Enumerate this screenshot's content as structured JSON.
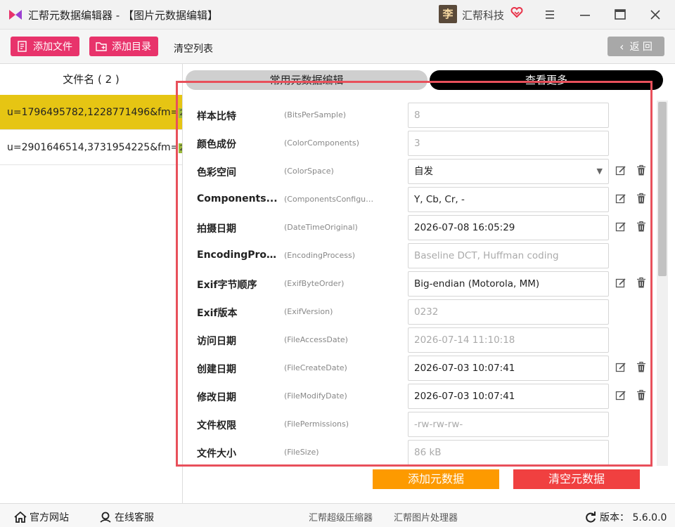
{
  "window": {
    "title": "汇帮元数据编辑器 - 【图片元数据编辑】",
    "brand_avatar_char": "李",
    "brand_name": "汇帮科技"
  },
  "toolbar": {
    "add_file": "添加文件",
    "add_dir": "添加目录",
    "clear_list": "清空列表",
    "back": "返 回"
  },
  "file_list": {
    "header": "文件名 ( 2 )",
    "items": [
      {
        "name": "u=1796495782,1228771496&fm=",
        "tag": "2(",
        "selected": true
      },
      {
        "name": "u=2901646514,3731954225&fm=",
        "tag": "2(",
        "selected": false
      }
    ]
  },
  "tabs": {
    "common": "常用元数据编辑",
    "more": "查看更多"
  },
  "fields": [
    {
      "cn": "样本比特",
      "en": "(BitsPerSample)",
      "value": "8",
      "editable": false
    },
    {
      "cn": "颜色成份",
      "en": "(ColorComponents)",
      "value": "3",
      "editable": false
    },
    {
      "cn": "色彩空间",
      "en": "(ColorSpace)",
      "value": "自发",
      "editable": true,
      "dropdown": true
    },
    {
      "cn": "Components...",
      "en": "(ComponentsConfigur...",
      "value": "Y, Cb, Cr, -",
      "editable": true
    },
    {
      "cn": "拍摄日期",
      "en": "(DateTimeOriginal)",
      "value": "2026-07-08 16:05:29",
      "editable": true
    },
    {
      "cn": "EncodingProc...",
      "en": "(EncodingProcess)",
      "value": "Baseline DCT, Huffman coding",
      "editable": false
    },
    {
      "cn": "Exif字节顺序",
      "en": "(ExifByteOrder)",
      "value": "Big-endian (Motorola, MM)",
      "editable": true
    },
    {
      "cn": "Exif版本",
      "en": "(ExifVersion)",
      "value": "0232",
      "editable": false
    },
    {
      "cn": "访问日期",
      "en": "(FileAccessDate)",
      "value": "2026-07-14 11:10:18",
      "editable": false
    },
    {
      "cn": "创建日期",
      "en": "(FileCreateDate)",
      "value": "2026-07-03 10:07:41",
      "editable": true
    },
    {
      "cn": "修改日期",
      "en": "(FileModifyDate)",
      "value": "2026-07-03 10:07:41",
      "editable": true
    },
    {
      "cn": "文件权限",
      "en": "(FilePermissions)",
      "value": "-rw-rw-rw-",
      "editable": false
    },
    {
      "cn": "文件大小",
      "en": "(FileSize)",
      "value": "86 kB",
      "editable": false
    }
  ],
  "actions": {
    "add_meta": "添加元数据",
    "clear_meta": "清空元数据"
  },
  "footer": {
    "website": "官方网站",
    "service": "在线客服",
    "compressor": "汇帮超级压缩器",
    "image_tool": "汇帮图片处理器",
    "version": "版本： 5.6.0.0"
  },
  "colors": {
    "accent_pink": "#e8336b",
    "selected_row": "#e6c513",
    "orange": "#fd9a00",
    "red": "#f04040"
  }
}
